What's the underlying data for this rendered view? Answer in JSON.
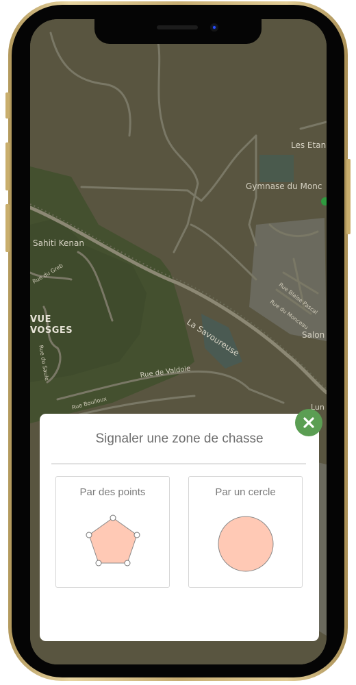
{
  "map": {
    "labels": {
      "les_etangs": "Les Etan",
      "gymnase": "Gymnase du Monc",
      "sahiti": "Sahiti Kenan",
      "la_savoureuse": "La Savoureuse",
      "vue": "VUE",
      "vosges": "VOSGES",
      "rue_blaise_pascal": "Rue Blaise Pascal",
      "rue_du_monceau": "Rue du Monceau",
      "salon": "Salon",
      "rue_de_valdoie": "Rue de Valdoie",
      "rue_boulloux": "Rue Boulloux",
      "rue_du_greb": "Rue du Greb",
      "rue_du_saule": "Rue du Saule",
      "rue_lun": "Lun"
    }
  },
  "modal": {
    "title": "Signaler une zone de chasse",
    "options": [
      {
        "label": "Par des points",
        "icon": "pentagon-icon"
      },
      {
        "label": "Par un cercle",
        "icon": "circle-icon"
      }
    ],
    "close_icon": "close-icon"
  },
  "colors": {
    "accent_green": "#5b9e53",
    "shape_fill": "#ffc9b5",
    "map_overlay": "#5a5641"
  }
}
